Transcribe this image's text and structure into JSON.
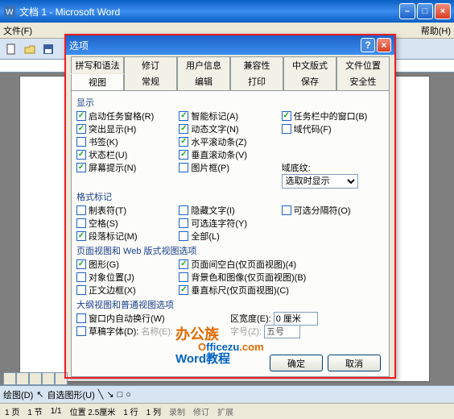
{
  "window": {
    "title": "文档 1 - Microsoft Word"
  },
  "menubar": {
    "file": "文件(F)",
    "help_fragment": "帮助(H)"
  },
  "dialog": {
    "title": "选项",
    "tabs_row1": [
      "拼写和语法",
      "修订",
      "用户信息",
      "兼容性",
      "中文版式",
      "文件位置"
    ],
    "tabs_row2": [
      "视图",
      "常规",
      "编辑",
      "打印",
      "保存",
      "安全性"
    ],
    "active_tab": "视图",
    "groups": {
      "display": {
        "label": "显示",
        "col1": [
          {
            "label": "启动任务窗格(R)",
            "checked": true
          },
          {
            "label": "突出显示(H)",
            "checked": true
          },
          {
            "label": "书签(K)",
            "checked": false
          },
          {
            "label": "状态栏(U)",
            "checked": true
          },
          {
            "label": "屏幕提示(N)",
            "checked": true
          }
        ],
        "col2": [
          {
            "label": "智能标记(A)",
            "checked": true
          },
          {
            "label": "动态文字(N)",
            "checked": true
          },
          {
            "label": "水平滚动条(Z)",
            "checked": true
          },
          {
            "label": "垂直滚动条(V)",
            "checked": true
          },
          {
            "label": "图片框(P)",
            "checked": false
          }
        ],
        "col3": [
          {
            "label": "任务栏中的窗口(B)",
            "checked": true
          },
          {
            "label": "域代码(F)",
            "checked": false
          }
        ],
        "field_shading_label": "域底纹:",
        "field_shading_value": "选取时显示"
      },
      "marks": {
        "label": "格式标记",
        "col1": [
          {
            "label": "制表符(T)",
            "checked": false
          },
          {
            "label": "空格(S)",
            "checked": false
          },
          {
            "label": "段落标记(M)",
            "checked": true
          }
        ],
        "col2": [
          {
            "label": "隐藏文字(I)",
            "checked": false
          },
          {
            "label": "可选连字符(Y)",
            "checked": false
          },
          {
            "label": "全部(L)",
            "checked": false
          }
        ],
        "col3": [
          {
            "label": "可选分隔符(O)",
            "checked": false
          }
        ]
      },
      "page_web": {
        "label": "页面视图和 Web 版式视图选项",
        "col1": [
          {
            "label": "图形(G)",
            "checked": true
          },
          {
            "label": "对象位置(J)",
            "checked": false
          },
          {
            "label": "正文边框(X)",
            "checked": false
          }
        ],
        "col2": [
          {
            "label": "页面间空白(仅页面视图)(4)",
            "checked": true
          },
          {
            "label": "背景色和图像(仅页面视图)(B)",
            "checked": false
          },
          {
            "label": "垂直标尺(仅页面视图)(C)",
            "checked": true
          }
        ]
      },
      "outline": {
        "label": "大纲视图和普通视图选项",
        "wrap": {
          "label": "窗口内自动换行(W)",
          "checked": false
        },
        "draft": {
          "label": "草稿字体(D):",
          "checked": false
        },
        "name_label": "名称(E):",
        "width_label": "区宽度(E):",
        "width_value": "0 厘米",
        "size_label": "字号(Z):",
        "size_value": "五号"
      }
    },
    "ok": "确定",
    "cancel": "取消"
  },
  "drawbar": {
    "draw": "绘图(D)",
    "autoshape": "自选图形(U)"
  },
  "statusbar": {
    "page": "1 页",
    "sec": "1 节",
    "pages": "1/1",
    "pos": "位置 2.5厘米",
    "line": "1 行",
    "col": "1 列",
    "rec": "录制",
    "rev": "修订",
    "ext": "扩展"
  },
  "watermark": {
    "l1": "办公族",
    "l2a": "O",
    "l2b": "fficezu",
    "l2c": ".com",
    "l3": "Word教程"
  }
}
